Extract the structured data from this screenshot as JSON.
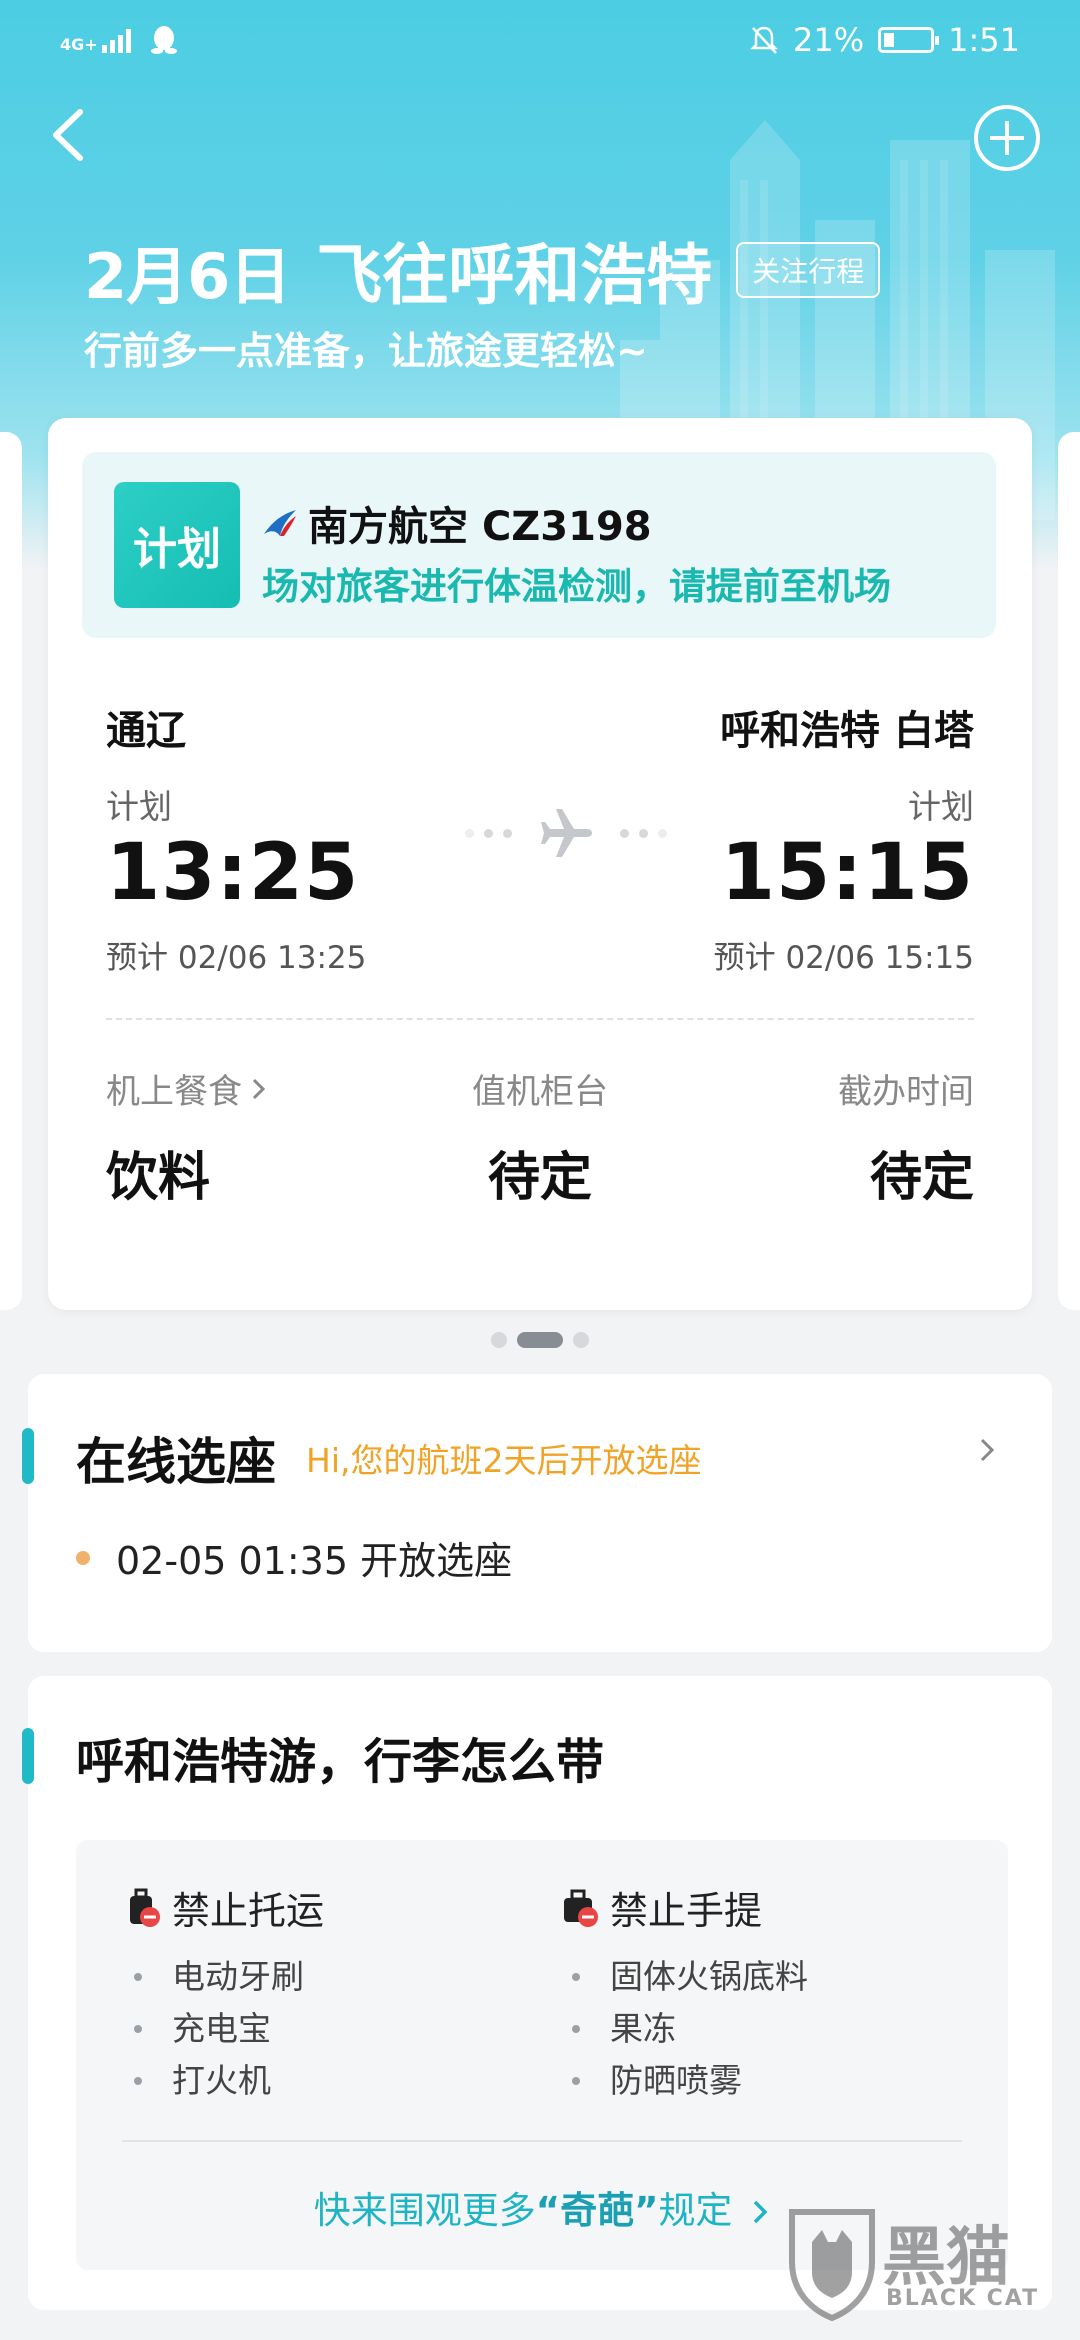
{
  "status_bar": {
    "network": "4G+",
    "battery_percent": "21%",
    "time": "1:51"
  },
  "header": {
    "date": "2月6日",
    "destination_title": "飞往呼和浩特",
    "follow_label": "关注行程",
    "subtitle": "行前多一点准备，让旅途更轻松~"
  },
  "flight": {
    "status": "计划",
    "airline": "南方航空",
    "flight_no": "CZ3198",
    "notice": "场对旅客进行体温检测，请提前至机场",
    "from_city": "通辽",
    "to_city": "呼和浩特 白塔",
    "from_label": "计划",
    "to_label": "计划",
    "dep_time": "13:25",
    "arr_time": "15:15",
    "dep_est": "预计 02/06 13:25",
    "arr_est": "预计 02/06 15:15",
    "meal_label": "机上餐食",
    "meal_value": "饮料",
    "counter_label": "值机柜台",
    "counter_value": "待定",
    "cutoff_label": "截办时间",
    "cutoff_value": "待定"
  },
  "pager": {
    "count": 3,
    "active": 1
  },
  "seat": {
    "title": "在线选座",
    "hint": "Hi,您的航班2天后开放选座",
    "open_text": "02-05 01:35 开放选座"
  },
  "luggage": {
    "title": "呼和浩特游，行李怎么带",
    "checked": {
      "title": "禁止托运",
      "items": [
        "电动牙刷",
        "充电宝",
        "打火机"
      ]
    },
    "carry": {
      "title": "禁止手提",
      "items": [
        "固体火锅底料",
        "果冻",
        "防晒喷雾"
      ]
    },
    "more_prefix": "快来围观更多",
    "more_highlight": "“奇葩”",
    "more_suffix": "规定"
  },
  "watermark": {
    "text": "黑猫",
    "sub": "BLACK CAT"
  },
  "colors": {
    "accent": "#1fb9c8",
    "status_tag": "#15bdb2",
    "hint_orange": "#f0a326"
  }
}
